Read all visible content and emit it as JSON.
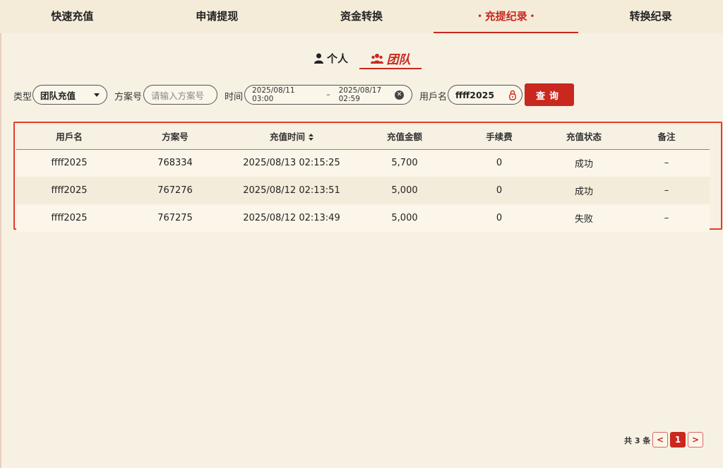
{
  "top_tabs": [
    {
      "label": "快速充值"
    },
    {
      "label": "申请提现"
    },
    {
      "label": "资金转换"
    },
    {
      "label": "充提纪录",
      "active": true
    },
    {
      "label": "转换纪录"
    }
  ],
  "active_mark": "•",
  "sub_tabs": {
    "personal": "个人",
    "team": "团队"
  },
  "filters": {
    "type_label": "类型",
    "type_value": "团队充值",
    "plan_label": "方案号",
    "plan_placeholder": "请输入方案号",
    "time_label": "时间",
    "date_start": "2025/08/11 03:00",
    "date_sep": "–",
    "date_end": "2025/08/17 02:59",
    "user_label": "用戶名",
    "user_value": "ffff2025",
    "query_button": "查询"
  },
  "table": {
    "headers": [
      "用戶名",
      "方案号",
      "充值时间",
      "充值金额",
      "手续费",
      "充值状态",
      "备注"
    ],
    "rows": [
      [
        "ffff2025",
        "768334",
        "2025/08/13 02:15:25",
        "5,700",
        "0",
        "成功",
        "–"
      ],
      [
        "ffff2025",
        "767276",
        "2025/08/12 02:13:51",
        "5,000",
        "0",
        "成功",
        "–"
      ],
      [
        "ffff2025",
        "767275",
        "2025/08/12 02:13:49",
        "5,000",
        "0",
        "失败",
        "–"
      ]
    ]
  },
  "pagination": {
    "total_text": "共 3 条",
    "current_page": "1",
    "prev": "<",
    "next": ">"
  },
  "colors": {
    "accent": "#c8281e",
    "background": "#f7f1e3",
    "highlight_border": "#e53b2c"
  }
}
